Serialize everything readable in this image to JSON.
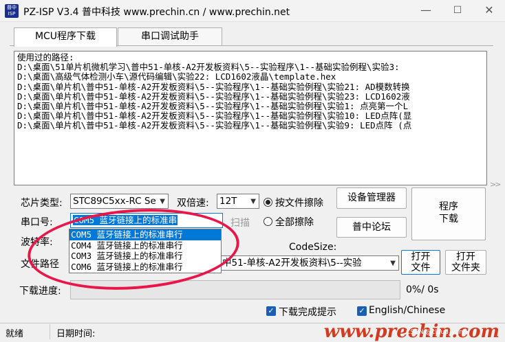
{
  "window": {
    "icon_text": "普中ISP",
    "title": "PZ-ISP V3.4 普中科技 www.prechin.cn / www.prechin.net",
    "minimize_glyph": "—",
    "maximize_glyph": "☐",
    "close_glyph": "✕"
  },
  "tabs": [
    {
      "label": "MCU程序下载",
      "active": true
    },
    {
      "label": "串口调试助手",
      "active": false
    }
  ],
  "history": {
    "header": "使用过的路径:",
    "paths": [
      "D:\\桌面\\51单片机微机学习\\普中51-单核-A2开发板资料\\5--实验程序\\1--基础实验例程\\实验3:",
      "D:\\桌面\\高级气体检测小车\\源代码编辑\\实验22: LCD1602液晶\\template.hex",
      "D:\\桌面\\单片机\\普中51-单核-A2开发板资料\\5--实验程序\\1--基础实验例程\\实验21: AD模数转换",
      "D:\\桌面\\单片机\\普中51-单核-A2开发板资料\\5--实验程序\\1--基础实验例程\\实验23: LCD1602液",
      "D:\\桌面\\单片机\\普中51-单核-A2开发板资料\\5--实验程序\\1--基础实验例程\\实验1: 点亮第一个L",
      "D:\\桌面\\单片机\\普中51-单核-A2开发板资料\\5--实验程序\\1--基础实验例程\\实验10: LED点阵(显",
      "D:\\桌面\\单片机\\普中51-单核-A2开发板资料\\5--实验程序\\1--基础实验例程\\实验9: LED点阵 (点"
    ],
    "scroll_glyph": ">>"
  },
  "chip": {
    "label": "芯片类型:",
    "value": "STC89C5xx-RC Se"
  },
  "speed": {
    "label": "双倍速:",
    "value": "12T"
  },
  "erase": {
    "by_file_label": "按文件擦除",
    "all_label": "全部擦除",
    "selected": "by_file"
  },
  "buttons": {
    "device_manager": "设备管理器",
    "program_line1": "程序",
    "program_line2": "下载",
    "scan": "扫描",
    "forum": "普中论坛",
    "open_file_line1": "打开",
    "open_file_line2": "文件",
    "open_folder_line1": "打开",
    "open_folder_line2": "文件夹"
  },
  "serial": {
    "label": "串口号:",
    "value": "COM5  蓝牙链接上的标准串",
    "options": [
      {
        "label": "COM5  蓝牙链接上的标准串行",
        "selected": true
      },
      {
        "label": "COM4  蓝牙链接上的标准串行",
        "selected": false
      },
      {
        "label": "COM3  蓝牙链接上的标准串行",
        "selected": false
      },
      {
        "label": "COM6  蓝牙链接上的标准串行",
        "selected": false
      }
    ]
  },
  "baud": {
    "label": "波特率:"
  },
  "codesize": {
    "label": "CodeSize:"
  },
  "filepath": {
    "label": "文件路径",
    "value": "中51-单核-A2开发板资料\\5--实验"
  },
  "progress": {
    "label": "下载进度:",
    "percent_text": "0%/ 0s",
    "fraction": 0
  },
  "checkboxes": {
    "download_notify": {
      "label": "下载完成提示",
      "checked": true
    },
    "language": {
      "label": "English/Chinese",
      "checked": true
    }
  },
  "status": {
    "state": "就绪",
    "date_label": "日期时间:"
  },
  "watermark": {
    "main": "www.prechin.com",
    "sub": "CSDN @cloud_yang"
  },
  "colors": {
    "accent": "#0078d7",
    "annotation": "#e8174a",
    "watermark": "#d23b1f"
  }
}
